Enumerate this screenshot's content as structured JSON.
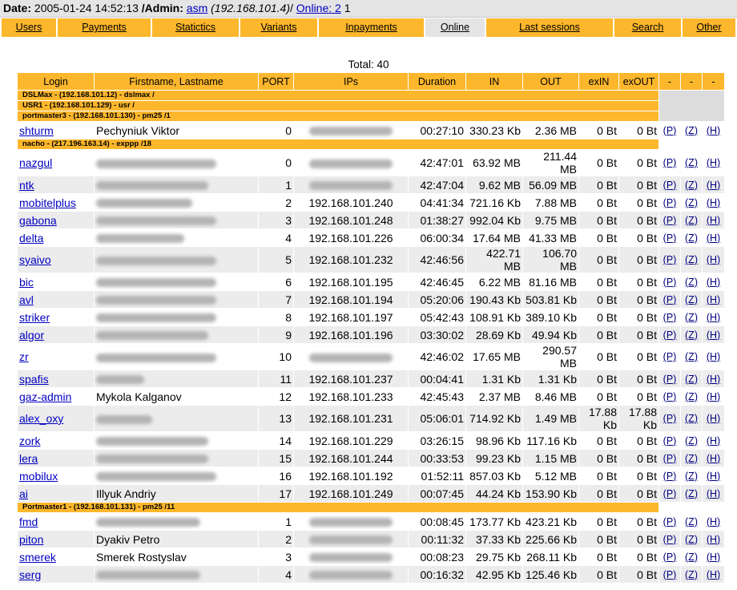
{
  "topbar": {
    "date_label": "Date:",
    "date_value": "2005-01-24 14:52:13",
    "admin_label": "/Admin:",
    "admin_user": "asm",
    "admin_ip": "(192.168.101.4)",
    "online_sep": "/",
    "online_link": "Online: 2",
    "online_extra": "1"
  },
  "nav": [
    "Users",
    "Payments",
    "Statictics",
    "Variants",
    "Inpayments",
    "Online",
    "Last sessions",
    "Search",
    "Other"
  ],
  "total_text": "Total: 40",
  "columns": [
    "Login",
    "Firstname, Lastname",
    "PORT",
    "IPs",
    "Duration",
    "IN",
    "OUT",
    "exIN",
    "exOUT",
    "-",
    "-",
    "-"
  ],
  "links": {
    "p": "(P)",
    "z": "(Z)",
    "h": "(H)"
  },
  "groups": [
    "DSLMax - (192.168.101.12) - dslmax /",
    "USR1 - (192.168.101.129) - usr /",
    "portmaster3 - (192.168.101.130) - pm25 /1",
    "nacho - (217.196.163.14) - exppp /18",
    "Portmaster1 - (192.168.101.131) - pm25 /11"
  ],
  "rows_pm3": [
    {
      "login": "shturm",
      "name": "Pechyniuk Viktor",
      "port": "0",
      "ip": "",
      "dur": "00:27:10",
      "in": "330.23 Kb",
      "out": "2.36 MB",
      "exin": "0 Bt",
      "exout": "0 Bt"
    }
  ],
  "rows_nacho": [
    {
      "login": "nazgul",
      "name": "",
      "port": "0",
      "ip": "",
      "dur": "42:47:01",
      "in": "63.92 MB",
      "out": "211.44 MB",
      "exin": "0 Bt",
      "exout": "0 Bt"
    },
    {
      "login": "ntk",
      "name": "",
      "port": "1",
      "ip": "",
      "dur": "42:47:04",
      "in": "9.62 MB",
      "out": "56.09 MB",
      "exin": "0 Bt",
      "exout": "0 Bt"
    },
    {
      "login": "mobitelplus",
      "name": "",
      "port": "2",
      "ip": "192.168.101.240",
      "dur": "04:41:34",
      "in": "721.16 Kb",
      "out": "7.88 MB",
      "exin": "0 Bt",
      "exout": "0 Bt"
    },
    {
      "login": "gabona",
      "name": "",
      "port": "3",
      "ip": "192.168.101.248",
      "dur": "01:38:27",
      "in": "992.04 Kb",
      "out": "9.75 MB",
      "exin": "0 Bt",
      "exout": "0 Bt"
    },
    {
      "login": "delta",
      "name": "",
      "port": "4",
      "ip": "192.168.101.226",
      "dur": "06:00:34",
      "in": "17.64 MB",
      "out": "41.33 MB",
      "exin": "0 Bt",
      "exout": "0 Bt"
    },
    {
      "login": "syaivo",
      "name": "",
      "port": "5",
      "ip": "192.168.101.232",
      "dur": "42:46:56",
      "in": "422.71 MB",
      "out": "106.70 MB",
      "exin": "0 Bt",
      "exout": "0 Bt",
      "tall": true
    },
    {
      "login": "bic",
      "name": "",
      "port": "6",
      "ip": "192.168.101.195",
      "dur": "42:46:45",
      "in": "6.22 MB",
      "out": "81.16 MB",
      "exin": "0 Bt",
      "exout": "0 Bt"
    },
    {
      "login": "avl",
      "name": "",
      "port": "7",
      "ip": "192.168.101.194",
      "dur": "05:20:06",
      "in": "190.43 Kb",
      "out": "503.81 Kb",
      "exin": "0 Bt",
      "exout": "0 Bt"
    },
    {
      "login": "striker",
      "name": "",
      "port": "8",
      "ip": "192.168.101.197",
      "dur": "05:42:43",
      "in": "108.91 Kb",
      "out": "389.10 Kb",
      "exin": "0 Bt",
      "exout": "0 Bt"
    },
    {
      "login": "algor",
      "name": "",
      "port": "9",
      "ip": "192.168.101.196",
      "dur": "03:30:02",
      "in": "28.69 Kb",
      "out": "49.94 Kb",
      "exin": "0 Bt",
      "exout": "0 Bt"
    },
    {
      "login": "zr",
      "name": "",
      "port": "10",
      "ip": "",
      "dur": "42:46:02",
      "in": "17.65 MB",
      "out": "290.57 MB",
      "exin": "0 Bt",
      "exout": "0 Bt"
    },
    {
      "login": "spafis",
      "name": "",
      "port": "11",
      "ip": "192.168.101.237",
      "dur": "00:04:41",
      "in": "1.31 Kb",
      "out": "1.31 Kb",
      "exin": "0 Bt",
      "exout": "0 Bt"
    },
    {
      "login": "gaz-admin",
      "name": "Mykola Kalganov",
      "port": "12",
      "ip": "192.168.101.233",
      "dur": "42:45:43",
      "in": "2.37 MB",
      "out": "8.46 MB",
      "exin": "0 Bt",
      "exout": "0 Bt"
    },
    {
      "login": "alex_oxy",
      "name": "",
      "port": "13",
      "ip": "192.168.101.231",
      "dur": "05:06:01",
      "in": "714.92 Kb",
      "out": "1.49 MB",
      "exin": "17.88 Kb",
      "exout": "17.88 Kb",
      "tall": true
    },
    {
      "login": "zork",
      "name": "",
      "port": "14",
      "ip": "192.168.101.229",
      "dur": "03:26:15",
      "in": "98.96 Kb",
      "out": "117.16 Kb",
      "exin": "0 Bt",
      "exout": "0 Bt"
    },
    {
      "login": "lera",
      "name": "",
      "port": "15",
      "ip": "192.168.101.244",
      "dur": "00:33:53",
      "in": "99.23 Kb",
      "out": "1.15 MB",
      "exin": "0 Bt",
      "exout": "0 Bt"
    },
    {
      "login": "mobilux",
      "name": "",
      "port": "16",
      "ip": "192.168.101.192",
      "dur": "01:52:11",
      "in": "857.03 Kb",
      "out": "5.12 MB",
      "exin": "0 Bt",
      "exout": "0 Bt"
    },
    {
      "login": "ai",
      "name": "Illyuk Andriy",
      "port": "17",
      "ip": "192.168.101.249",
      "dur": "00:07:45",
      "in": "44.24 Kb",
      "out": "153.90 Kb",
      "exin": "0 Bt",
      "exout": "0 Bt"
    }
  ],
  "rows_pm1": [
    {
      "login": "fmd",
      "name": "",
      "port": "1",
      "ip": "",
      "dur": "00:08:45",
      "in": "173.77 Kb",
      "out": "423.21 Kb",
      "exin": "0 Bt",
      "exout": "0 Bt"
    },
    {
      "login": "piton",
      "name": "Dyakiv Petro",
      "port": "2",
      "ip": "",
      "dur": "00:11:32",
      "in": "37.33 Kb",
      "out": "225.66 Kb",
      "exin": "0 Bt",
      "exout": "0 Bt"
    },
    {
      "login": "smerek",
      "name": "Smerek Rostyslav",
      "port": "3",
      "ip": "",
      "dur": "00:08:23",
      "in": "29.75 Kb",
      "out": "268.11 Kb",
      "exin": "0 Bt",
      "exout": "0 Bt"
    },
    {
      "login": "serg",
      "name": "",
      "port": "4",
      "ip": "",
      "dur": "00:16:32",
      "in": "42.95 Kb",
      "out": "125.46 Kb",
      "exin": "0 Bt",
      "exout": "0 Bt"
    }
  ]
}
